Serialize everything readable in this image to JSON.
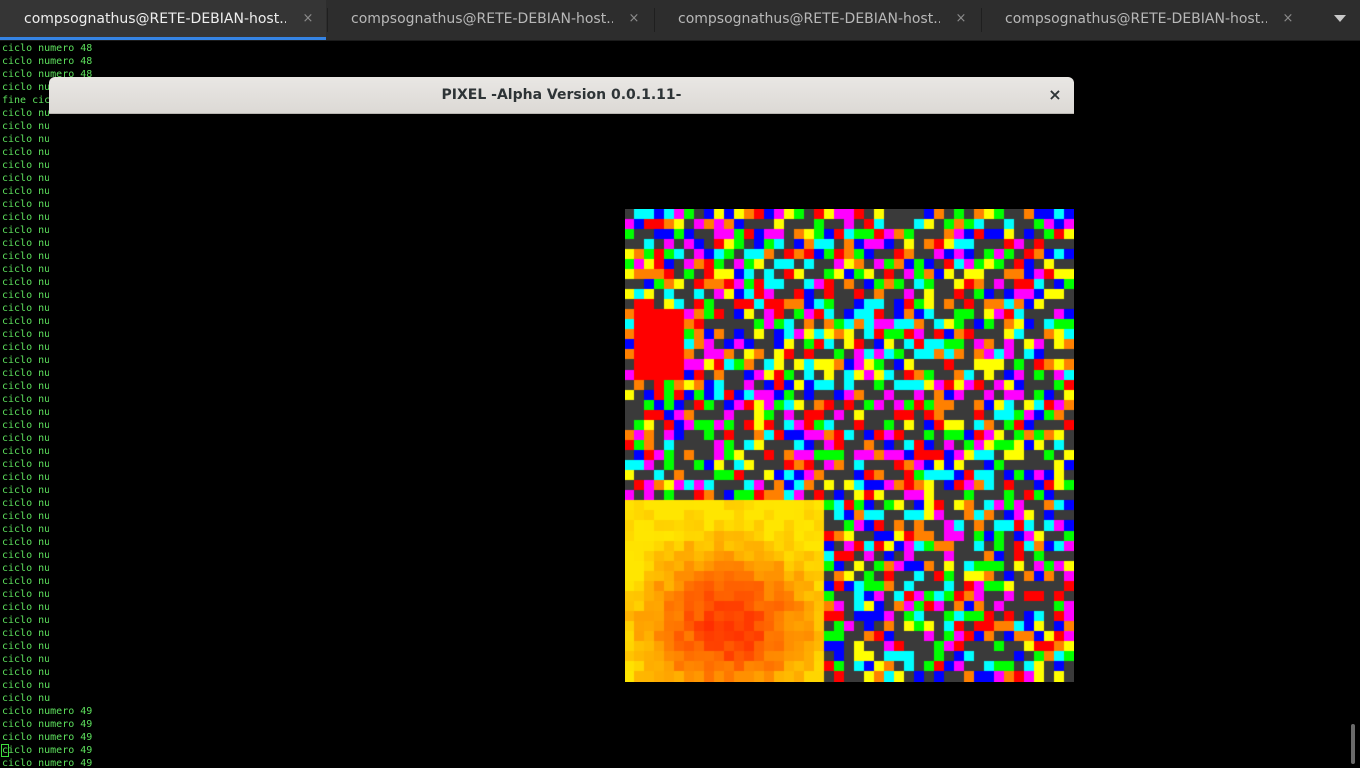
{
  "tabs": [
    {
      "label": "compsognathus@RETE-DEBIAN-host...",
      "close": "×",
      "active": true
    },
    {
      "label": "compsognathus@RETE-DEBIAN-host...",
      "close": "×",
      "active": false
    },
    {
      "label": "compsognathus@RETE-DEBIAN-host...",
      "close": "×",
      "active": false
    },
    {
      "label": "compsognathus@RETE-DEBIAN-host...",
      "close": "×",
      "active": false
    }
  ],
  "terminal": {
    "lines_full_top": [
      "ciclo numero 48",
      "ciclo numero 48",
      "ciclo numero 48"
    ],
    "lines_obscured": [
      "ciclo nu",
      "fine cic",
      "ciclo nu",
      "ciclo nu",
      "ciclo nu",
      "ciclo nu",
      "ciclo nu",
      "ciclo nu",
      "ciclo nu",
      "ciclo nu",
      "ciclo nu",
      "ciclo nu",
      "ciclo nu",
      "ciclo nu",
      "ciclo nu",
      "ciclo nu",
      "ciclo nu",
      "ciclo nu",
      "ciclo nu",
      "ciclo nu",
      "ciclo nu",
      "ciclo nu",
      "ciclo nu",
      "ciclo nu",
      "ciclo nu",
      "ciclo nu",
      "ciclo nu",
      "ciclo nu",
      "ciclo nu",
      "ciclo nu",
      "ciclo nu",
      "ciclo nu",
      "ciclo nu",
      "ciclo nu",
      "ciclo nu",
      "ciclo nu",
      "ciclo nu",
      "ciclo nu",
      "ciclo nu",
      "ciclo nu",
      "ciclo nu",
      "ciclo nu",
      "ciclo nu",
      "ciclo nu",
      "ciclo nu",
      "ciclo nu",
      "ciclo nu",
      "ciclo nu"
    ],
    "lines_full_bottom": [
      "ciclo numero 49",
      "ciclo numero 49",
      "ciclo numero 49",
      "ciclo numero 49",
      "ciclo numero 49"
    ],
    "text_color": "#5de05d"
  },
  "pixel_window": {
    "title": "PIXEL -Alpha Version 0.0.1.11-",
    "close_icon": "×",
    "grid": {
      "cols": 45,
      "rows": 47,
      "background": "#3a3a3a",
      "palette": [
        "#3a3a3a",
        "#ff0000",
        "#00ff00",
        "#0000ff",
        "#ffff00",
        "#00ffff",
        "#ff00ff",
        "#ff8000",
        "#3a3a3a",
        "#3a3a3a"
      ],
      "red_block": {
        "col0": 1,
        "row0": 10,
        "col1": 6,
        "row1": 17,
        "color": "#ff0000"
      },
      "fire_region": {
        "col0": 0,
        "row0": 29,
        "col1": 20,
        "row1": 47
      }
    }
  }
}
